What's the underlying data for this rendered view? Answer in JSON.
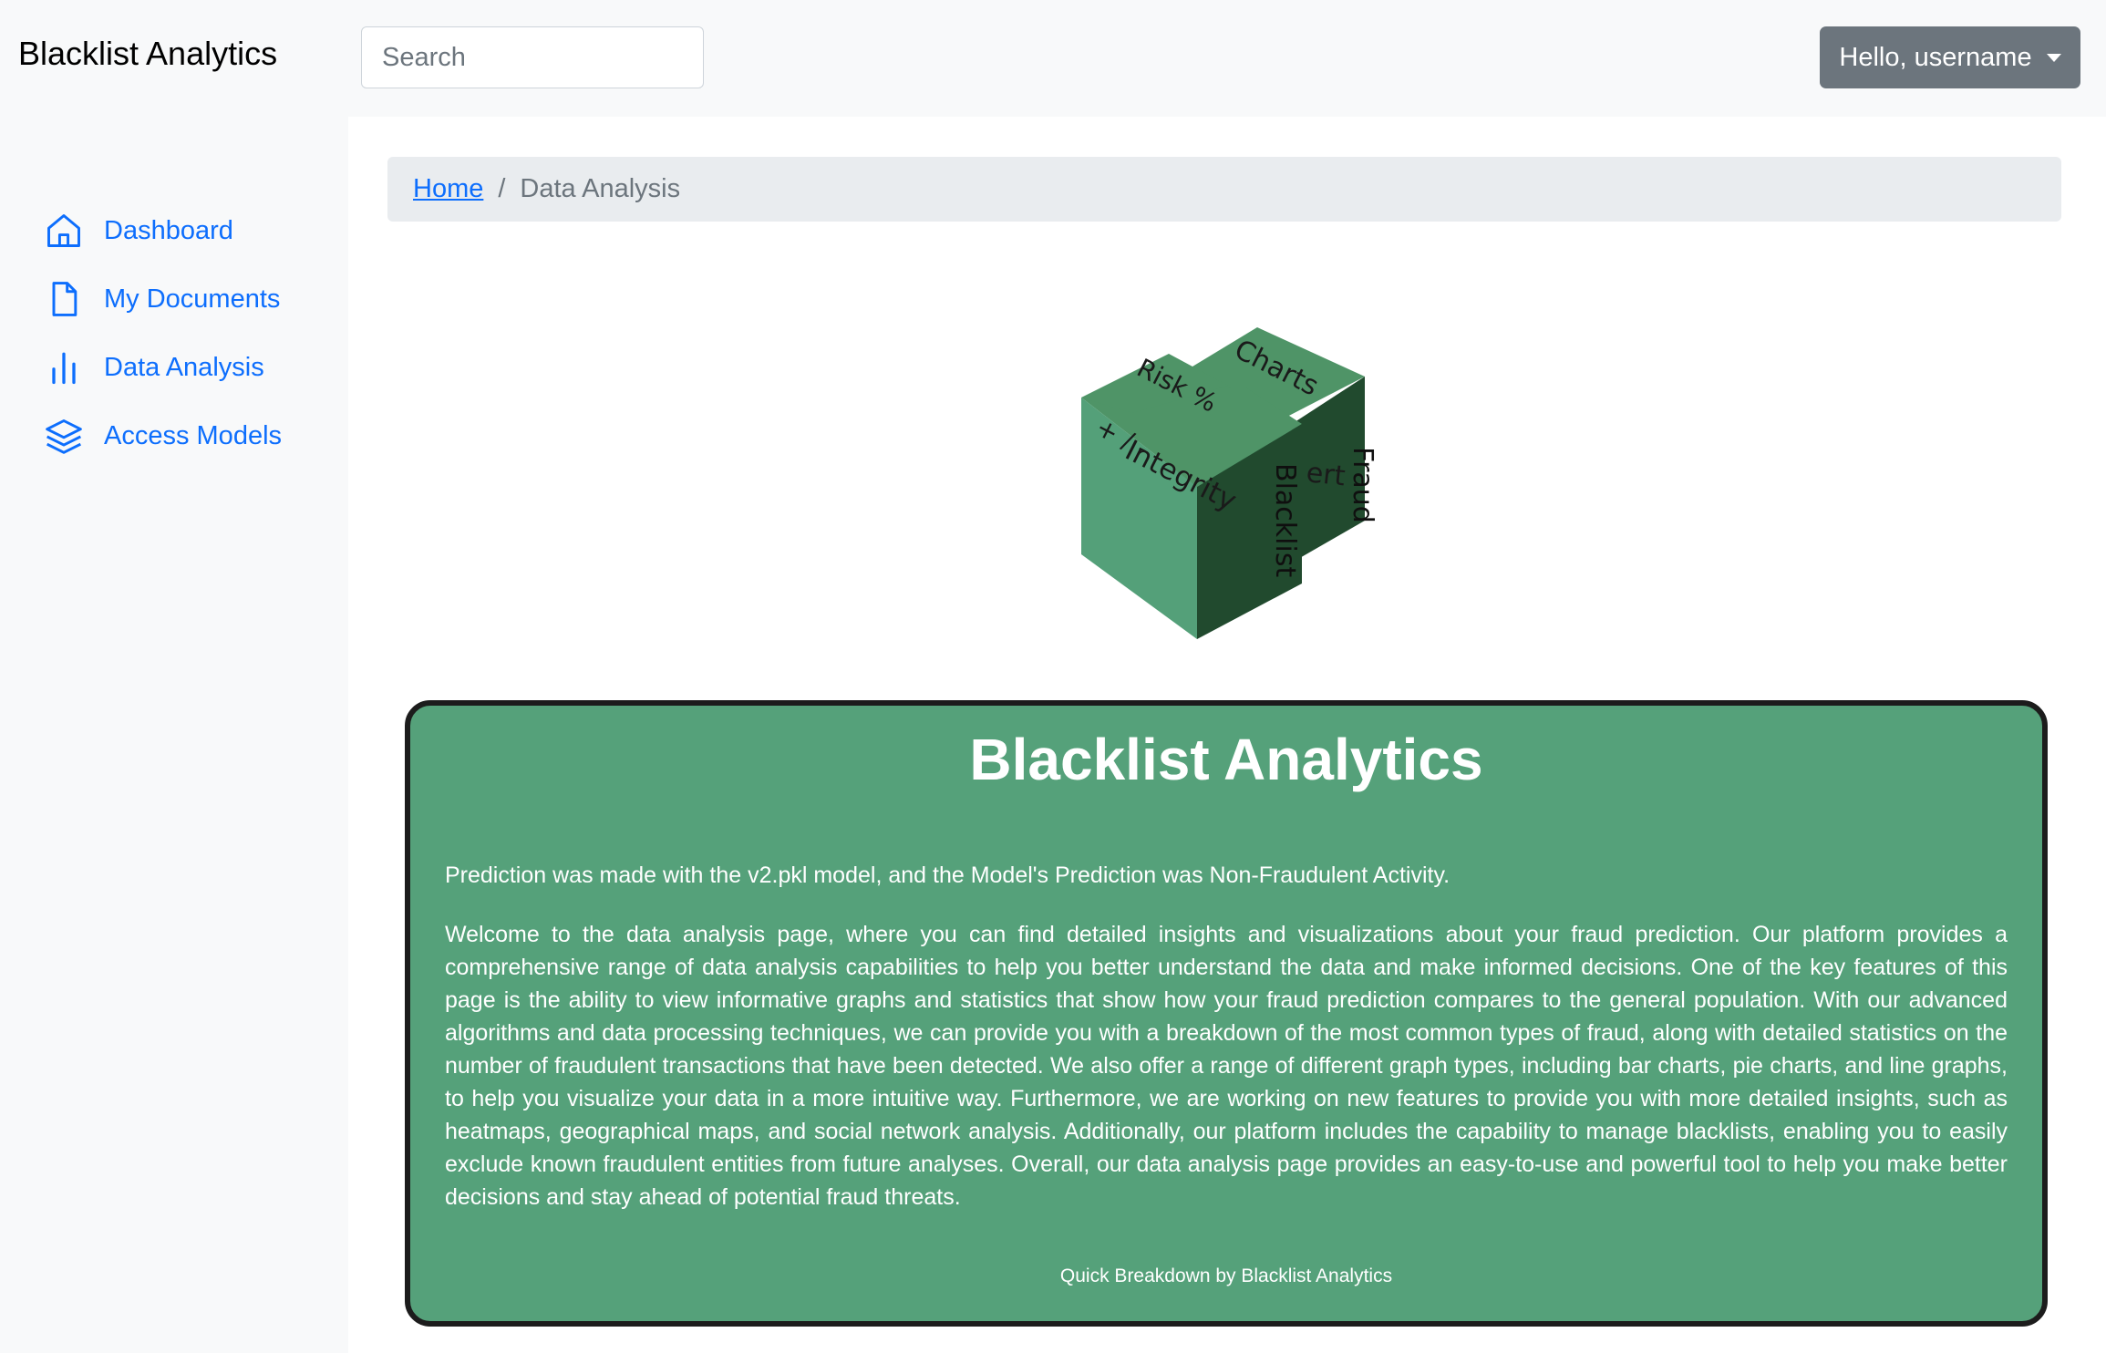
{
  "header": {
    "brand": "Blacklist Analytics",
    "search_placeholder": "Search",
    "user_menu_label": "Hello, username"
  },
  "sidebar": {
    "items": [
      {
        "label": "Dashboard",
        "icon": "home-icon"
      },
      {
        "label": "My Documents",
        "icon": "file-icon"
      },
      {
        "label": "Data Analysis",
        "icon": "bar-chart-icon"
      },
      {
        "label": "Access Models",
        "icon": "layers-icon"
      }
    ]
  },
  "breadcrumb": {
    "home": "Home",
    "separator": "/",
    "current": "Data Analysis"
  },
  "illustration": {
    "labels": {
      "charts": "Charts",
      "risk": "Risk %",
      "plus_minus": "+ / -",
      "integrity": "Integrity",
      "alert": "ert",
      "blacklist": "Blacklist",
      "fraud": "Fraud"
    },
    "colors": {
      "top": "#4f9467",
      "front": "#54a079",
      "side": "#214a2e"
    }
  },
  "card": {
    "title": "Blacklist Analytics",
    "prediction": "Prediction was made with the v2.pkl model, and the Model's Prediction was Non-Fraudulent Activity.",
    "description": "Welcome to the data analysis page, where you can find detailed insights and visualizations about your fraud prediction. Our platform provides a comprehensive range of data analysis capabilities to help you better understand the data and make informed decisions. One of the key features of this page is the ability to view informative graphs and statistics that show how your fraud prediction compares to the general population. With our advanced algorithms and data processing techniques, we can provide you with a breakdown of the most common types of fraud, along with detailed statistics on the number of fraudulent transactions that have been detected. We also offer a range of different graph types, including bar charts, pie charts, and line graphs, to help you visualize your data in a more intuitive way. Furthermore, we are working on new features to provide you with more detailed insights, such as heatmaps, geographical maps, and social network analysis. Additionally, our platform includes the capability to manage blacklists, enabling you to easily exclude known fraudulent entities from future analyses. Overall, our data analysis page provides an easy-to-use and powerful tool to help you make better decisions and stay ahead of potential fraud threats.",
    "footer": "Quick Breakdown by Blacklist Analytics",
    "background": "#55a17a"
  },
  "colors": {
    "link": "#0d6efd",
    "user_button": "#6c757d"
  }
}
